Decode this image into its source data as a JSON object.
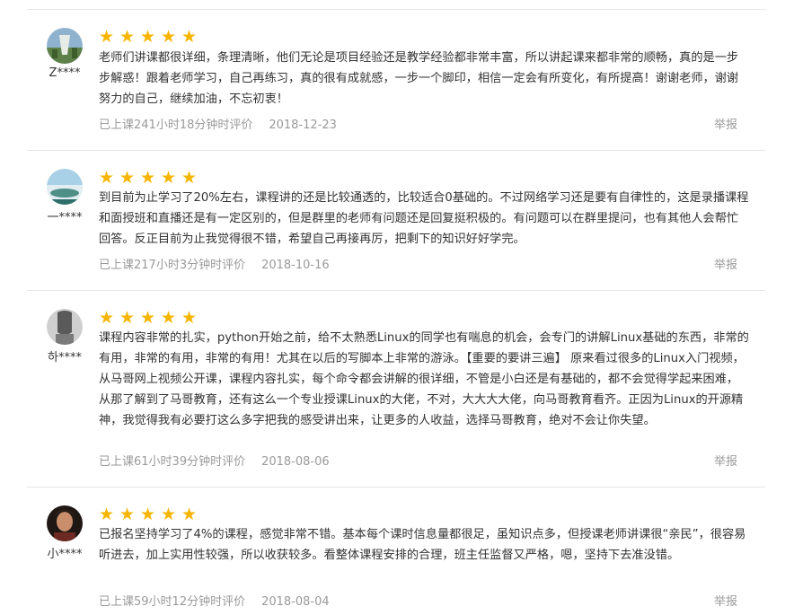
{
  "reviews": [
    {
      "user": "Z****",
      "rating": 5,
      "text": "老师们讲课都很详细，条理清晰，他们无论是项目经验还是教学经验都非常丰富，所以讲起课来都非常的顺畅，真的是一步步解惑！跟着老师学习，自己再练习，真的很有成就感，一步一个脚印，相信一定会有所变化，有所提高！谢谢老师，谢谢努力的自己，继续加油，不忘初衷！",
      "study_time": "已上课241小时18分钟时评价",
      "date": "2018-12-23",
      "report": "举报",
      "avatar_colors": [
        "#6a8fb0",
        "#c9d6c0",
        "#4b6b3a"
      ]
    },
    {
      "user": "一****",
      "rating": 5,
      "text": "到目前为止学习了20%左右，课程讲的还是比较通透的，比较适合0基础的。不过网络学习还是要有自律性的，这是录播课程和面授班和直播还是有一定区别的，但是群里的老师有问题还是回复挺积极的。有问题可以在群里提问，也有其他人会帮忙回答。反正目前为止我觉得很不错，希望自己再接再厉，把剩下的知识好好学完。",
      "study_time": "已上课217小时3分钟时评价",
      "date": "2018-10-16",
      "report": "举报",
      "avatar_colors": [
        "#7fb7d6",
        "#d8e8ef",
        "#3f7f7a"
      ]
    },
    {
      "user": "하****",
      "rating": 5,
      "text": "课程内容非常的扎实，python开始之前，给不太熟悉Linux的同学也有喘息的机会，会专门的讲解Linux基础的东西，非常的有用，非常的有用，非常的有用！尤其在以后的写脚本上非常的游泳。【重要的要讲三遍】 原来看过很多的Linux入门视频，从马哥网上视频公开课，课程内容扎实，每个命令都会讲解的很详细，不管是小白还是有基础的，都不会觉得学起来困难，从那了解到了马哥教育，还有这么一个专业授课Linux的大佬，不对，大大大大佬，向马哥教育看齐。正因为Linux的开源精神，我觉得我有必要打这么多字把我的感受讲出来，让更多的人收益，选择马哥教育，绝对不会让你失望。",
      "study_time": "已上课61小时39分钟时评价",
      "date": "2018-08-06",
      "report": "举报",
      "avatar_colors": [
        "#9a9a9a",
        "#d0d0d0",
        "#4a4a4a"
      ]
    },
    {
      "user": "小****",
      "rating": 5,
      "text": "已报名坚持学习了4%的课程，感觉非常不错。基本每个课时信息量都很足，虽知识点多，但授课老师讲课很“亲民”，很容易听进去，加上实用性较强，所以收获较多。看整体课程安排的合理，班主任监督又严格，嗯，坚持下去准没错。",
      "study_time": "已上课59小时12分钟时评价",
      "date": "2018-08-04",
      "report": "举报",
      "avatar_colors": [
        "#3a2a24",
        "#c98e6b",
        "#1c1614"
      ]
    }
  ]
}
